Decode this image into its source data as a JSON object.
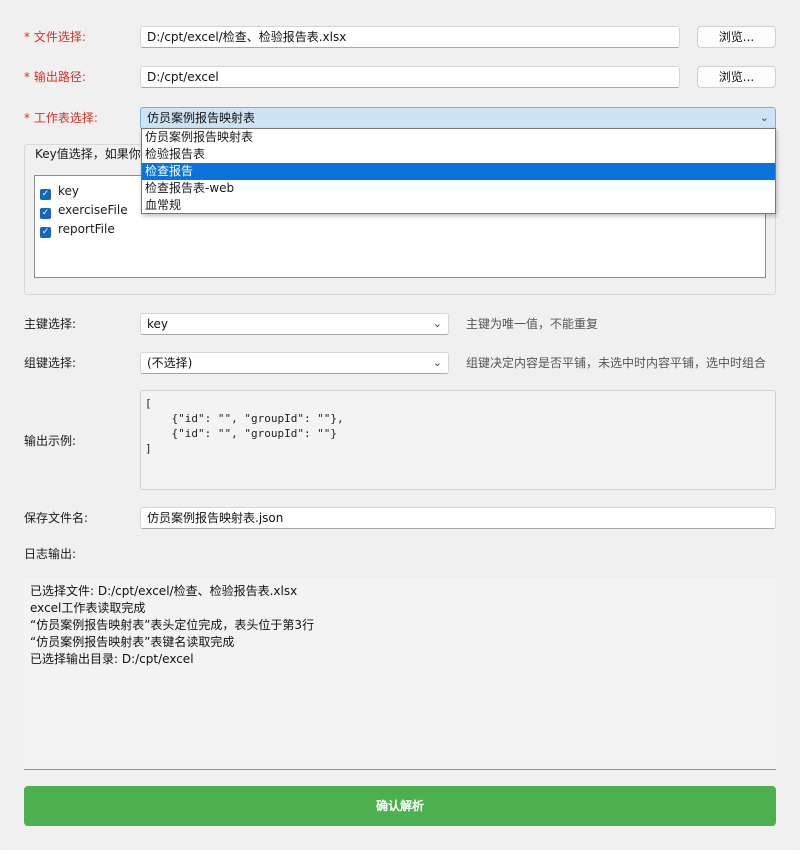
{
  "form": {
    "file_label": "* 文件选择:",
    "file_value": "D:/cpt/excel/检查、检验报告表.xlsx",
    "browse_label": "浏览...",
    "output_label": "* 输出路径:",
    "output_value": "D:/cpt/excel",
    "sheet_label": "* 工作表选择:",
    "sheet_value": "仿员案例报告映射表",
    "sheet_options": [
      "仿员案例报告映射表",
      "检验报告表",
      "检查报告",
      "检查报告表-web",
      "血常规"
    ],
    "sheet_highlighted": "检查报告",
    "key_group_title": "Key值选择，如果你",
    "key_items": [
      "key",
      "exerciseFile",
      "reportFile"
    ],
    "primary_label": "主键选择:",
    "primary_value": "key",
    "primary_hint": "主键为唯一值，不能重复",
    "group_label": "组键选择:",
    "group_value": "(不选择)",
    "group_hint": "组键决定内容是否平铺，未选中时内容平铺，选中时组合",
    "example_label": "输出示例:",
    "example_code": "[\n    {\"id\": \"\", \"groupId\": \"\"},\n    {\"id\": \"\", \"groupId\": \"\"}\n]",
    "save_label": "保存文件名:",
    "save_value": "仿员案例报告映射表.json",
    "log_label": "日志输出:"
  },
  "log_lines": [
    "已选择文件: D:/cpt/excel/检查、检验报告表.xlsx",
    "excel工作表读取完成",
    "“仿员案例报告映射表”表头定位完成，表头位于第3行",
    "“仿员案例报告映射表”表键名读取完成",
    "已选择输出目录: D:/cpt/excel"
  ],
  "confirm_label": "确认解析",
  "colors": {
    "required": "#d93025",
    "confirm": "#4caf50",
    "highlight": "#0a73d9"
  }
}
